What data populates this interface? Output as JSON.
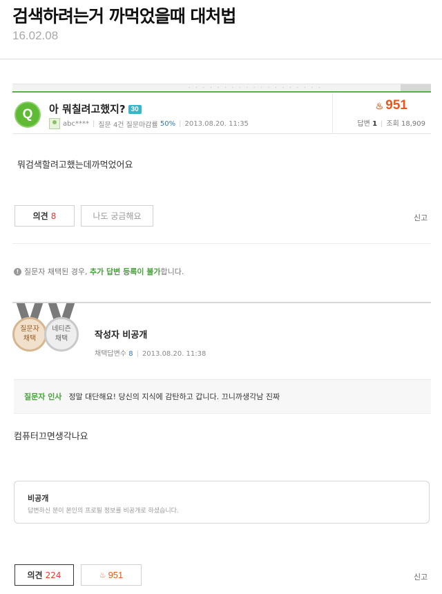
{
  "post": {
    "title": "검색하려는거 까먹었을때 대처법",
    "date": "16.02.08"
  },
  "question": {
    "badge": "Q",
    "title": "아 뭐칠려고했지?",
    "points": "30",
    "user": "abc****",
    "meta_stats": "질문 4건 질문마감률",
    "rate": "50%",
    "datetime": "2013.08.20. 11:35",
    "bounty": "951",
    "answers_label": "답변",
    "answers_count": "1",
    "views_label": "조회",
    "views_count": "18,909",
    "body": "뭐검색할려고했는데까먹었어요"
  },
  "actions_top": {
    "opinion_label": "의견",
    "opinion_count": "8",
    "curious_label": "나도 궁금해요",
    "report_label": "신고"
  },
  "notice": {
    "prefix": "질문자 채택된 경우,",
    "highlight": "추가 답변 등록이 불가",
    "suffix": "합니다."
  },
  "answer": {
    "medal_asker_line1": "질문자",
    "medal_asker_line2": "채택",
    "medal_netizen_line1": "네티즌",
    "medal_netizen_line2": "채택",
    "author": "작성자 비공개",
    "adopted_label": "채택답변수",
    "adopted_count": "8",
    "datetime": "2013.08.20. 11:38",
    "thanks_label": "질문자 인사",
    "thanks_text": "정말 대단해요! 당신의 지식에 감탄하고 갑니다. 끄니까생각남 진짜",
    "body": "컴퓨터끄면생각나요"
  },
  "private_profile": {
    "title": "비공개",
    "desc": "답변하신 분이 본인의 프로필 정보를 비공개로 하셨습니다."
  },
  "actions_bottom": {
    "opinion_label": "의견",
    "opinion_count": "224",
    "bounty": "951",
    "report_label": "신고"
  },
  "colors": {
    "accent_green": "#52b240",
    "bounty_orange": "#e8561b",
    "count_red": "#e4392f",
    "link_blue": "#2e78b8"
  }
}
